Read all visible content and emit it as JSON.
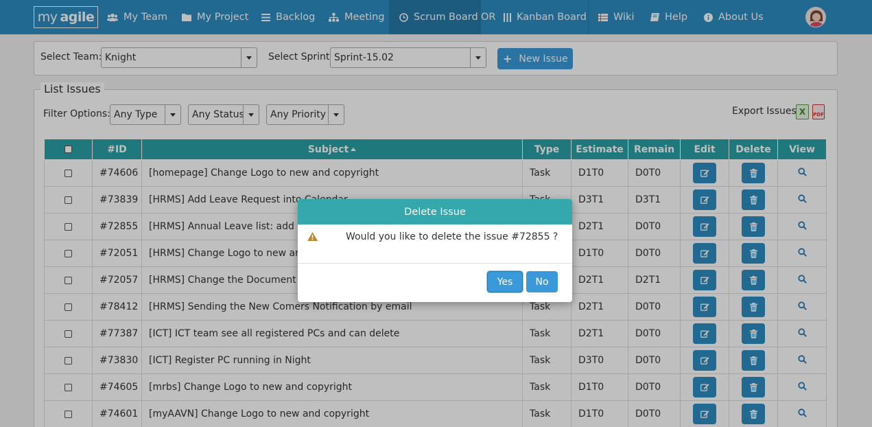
{
  "nav": {
    "logo_prefix": "my",
    "logo_brand": "agile",
    "items": [
      {
        "label": "My Team",
        "icon": "users-icon"
      },
      {
        "label": "My Project",
        "icon": "folder-icon"
      },
      {
        "label": "Backlog",
        "icon": "list-icon"
      },
      {
        "label": "Meeting",
        "icon": "sitemap-icon"
      },
      {
        "label": "Scrum Board",
        "icon": "clock-icon"
      },
      {
        "label": "Kanban Board",
        "icon": "columns-icon"
      },
      {
        "label": "Wiki",
        "icon": "table-icon"
      },
      {
        "label": "Help",
        "icon": "book-icon"
      },
      {
        "label": "About Us",
        "icon": "info-icon"
      }
    ],
    "or_text": "OR"
  },
  "filters": {
    "team_label": "Select Team:",
    "team_value": "Knight",
    "sprint_label": "Select Sprint:",
    "sprint_value": "Sprint-15.02",
    "new_issue": "New Issue"
  },
  "list": {
    "legend": "List Issues",
    "filter_label": "Filter Options:",
    "type_value": "Any Type",
    "status_value": "Any Status",
    "priority_value": "Any Priority",
    "export_label": "Export Issues"
  },
  "table": {
    "headers": {
      "id": "#ID",
      "subject": "Subject",
      "type": "Type",
      "estimate": "Estimate",
      "remain": "Remain",
      "edit": "Edit",
      "delete": "Delete",
      "view": "View"
    },
    "rows": [
      {
        "id": "#74606",
        "subject": "[homepage] Change Logo to new and copyright",
        "type": "Task",
        "estimate": "D1T0",
        "remain": "D0T0"
      },
      {
        "id": "#73839",
        "subject": "[HRMS] Add Leave Request into Calendar",
        "type": "Task",
        "estimate": "D3T1",
        "remain": "D3T1"
      },
      {
        "id": "#72855",
        "subject": "[HRMS] Annual Leave list: add Un",
        "type": "Task",
        "estimate": "D2T1",
        "remain": "D0T0"
      },
      {
        "id": "#72051",
        "subject": "[HRMS] Change Logo to new and",
        "type": "Task",
        "estimate": "D1T0",
        "remain": "D0T0"
      },
      {
        "id": "#72057",
        "subject": "[HRMS] Change the Document No",
        "type": "Task",
        "estimate": "D2T1",
        "remain": "D2T1"
      },
      {
        "id": "#78412",
        "subject": "[HRMS] Sending the New Comers Notification by email",
        "type": "Task",
        "estimate": "D2T1",
        "remain": "D0T0"
      },
      {
        "id": "#77387",
        "subject": "[ICT] ICT team see all registered PCs and can delete",
        "type": "Task",
        "estimate": "D2T1",
        "remain": "D0T0"
      },
      {
        "id": "#73830",
        "subject": "[ICT] Register PC running in Night",
        "type": "Task",
        "estimate": "D3T0",
        "remain": "D0T0"
      },
      {
        "id": "#74605",
        "subject": "[mrbs] Change Logo to new and copyright",
        "type": "Task",
        "estimate": "D1T0",
        "remain": "D0T0"
      },
      {
        "id": "#74601",
        "subject": "[myAAVN] Change Logo to new and copyright",
        "type": "Task",
        "estimate": "D1T0",
        "remain": "D0T0"
      }
    ]
  },
  "modal": {
    "title": "Delete Issue",
    "message": "Would you like to delete the issue #72855 ?",
    "yes": "Yes",
    "no": "No"
  },
  "colors": {
    "navbar": "#2d8cc2",
    "table_header": "#2aa1a5",
    "modal_header": "#34a8ac",
    "button": "#3a9ad9"
  }
}
